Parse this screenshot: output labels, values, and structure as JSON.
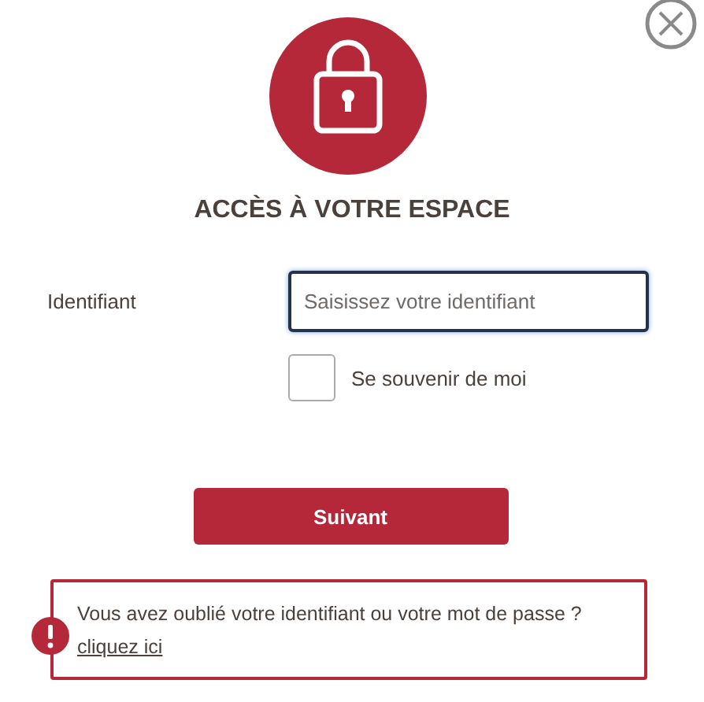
{
  "title": "ACCÈS À VOTRE ESPACE",
  "login_field": {
    "label": "Identifiant",
    "placeholder": "Saisissez votre identifiant"
  },
  "remember_me": {
    "label": "Se souvenir de moi",
    "checked": false
  },
  "submit_button": "Suivant",
  "notice": {
    "text": "Vous avez oublié votre identifiant ou votre mot de passe ? ",
    "link": "cliquez ici"
  }
}
